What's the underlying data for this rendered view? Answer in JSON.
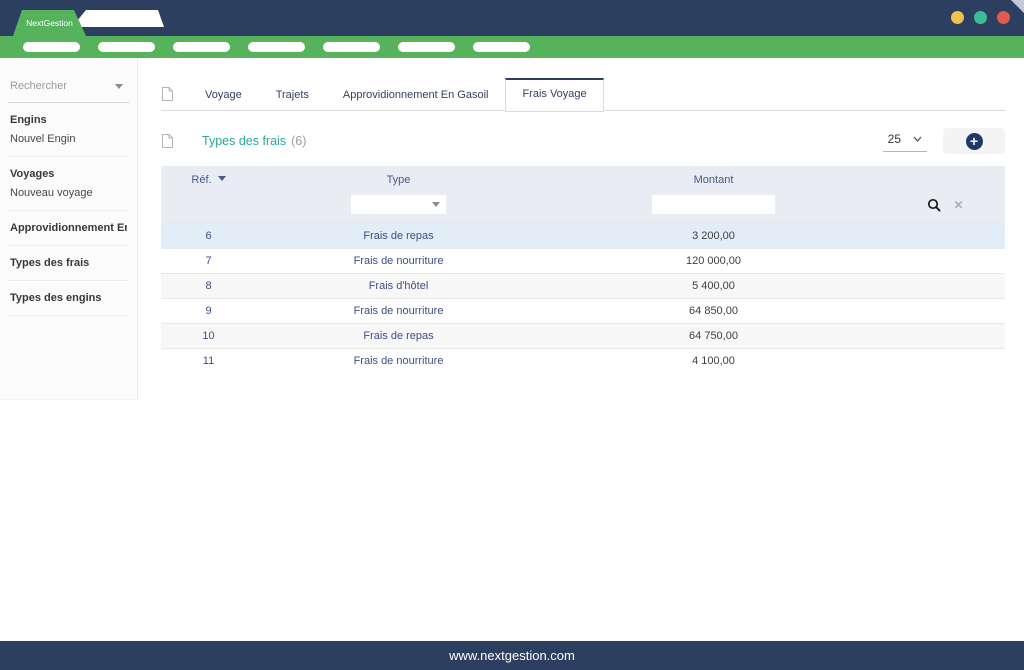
{
  "topbar": {
    "brand": "NextGestion",
    "window_dots": [
      {
        "name": "window-dot-yellow",
        "color": "#efc14e"
      },
      {
        "name": "window-dot-teal",
        "color": "#3cbd96"
      },
      {
        "name": "window-dot-red",
        "color": "#e15a4e"
      }
    ]
  },
  "navbar": {
    "pill_count": 7
  },
  "sidebar": {
    "search": {
      "placeholder": "Rechercher"
    },
    "groups": [
      {
        "title": "Engins",
        "items": [
          "Nouvel Engin"
        ]
      },
      {
        "title": "Voyages",
        "items": [
          "Nouveau voyage"
        ]
      },
      {
        "title": "Approvidionnement En ...",
        "items": []
      },
      {
        "title": "Types des frais",
        "items": []
      },
      {
        "title": "Types des engins",
        "items": []
      }
    ]
  },
  "main": {
    "tabs": [
      {
        "label": "Voyage",
        "active": false
      },
      {
        "label": "Trajets",
        "active": false
      },
      {
        "label": "Approvidionnement En Gasoil",
        "active": false
      },
      {
        "label": "Frais Voyage",
        "active": true
      }
    ],
    "section": {
      "title": "Types des frais",
      "count": "(6)",
      "page_size": "25"
    },
    "table": {
      "columns": [
        {
          "key": "ref",
          "label": "Réf.",
          "sortable": true
        },
        {
          "key": "type",
          "label": "Type",
          "sortable": false
        },
        {
          "key": "montant",
          "label": "Montant",
          "sortable": false
        }
      ],
      "rows": [
        {
          "ref": "6",
          "type": "Frais de repas",
          "montant": "3 200,00",
          "highlight": true
        },
        {
          "ref": "7",
          "type": "Frais de nourriture",
          "montant": "120 000,00",
          "highlight": false
        },
        {
          "ref": "8",
          "type": "Frais d'hôtel",
          "montant": "5 400,00",
          "highlight": false
        },
        {
          "ref": "9",
          "type": "Frais de nourriture",
          "montant": "64 850,00",
          "highlight": false
        },
        {
          "ref": "10",
          "type": "Frais de repas",
          "montant": "64 750,00",
          "highlight": false
        },
        {
          "ref": "11",
          "type": "Frais de nourriture",
          "montant": "4 100,00",
          "highlight": false
        }
      ]
    }
  },
  "footer": {
    "url": "www.nextgestion.com"
  }
}
